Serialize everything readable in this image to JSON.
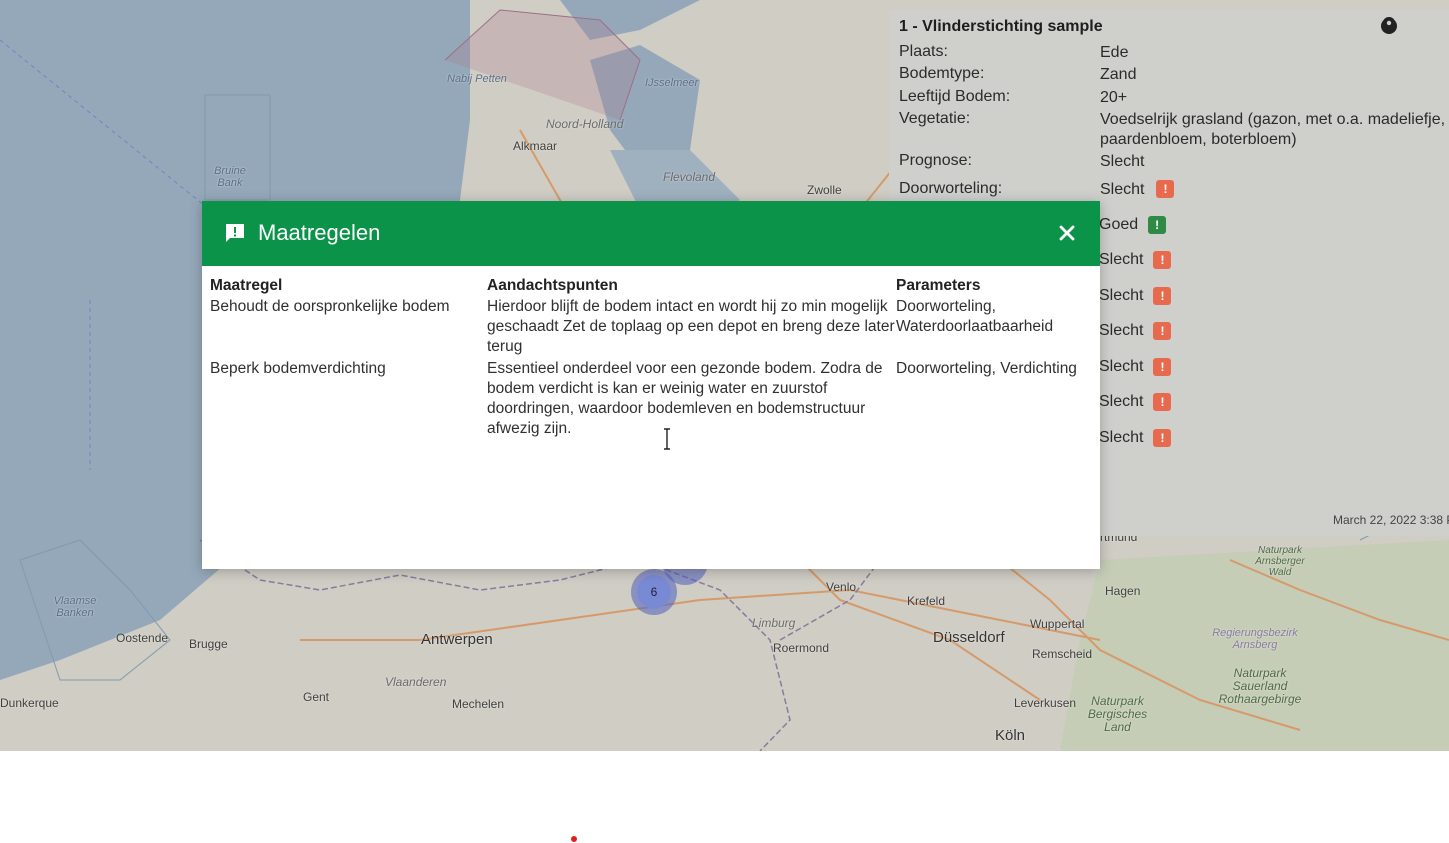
{
  "map": {
    "labels": {
      "nabij_petten": "Nabij Petten",
      "ijsselmeer": "IJsselmeer",
      "noord_holland": "Noord-Holland",
      "alkmaar": "Alkmaar",
      "flevoland": "Flevoland",
      "zwolle": "Zwolle",
      "bruine_bank": "Bruine Bank",
      "vlaamse_banken": "Vlaamse Banken",
      "oostende": "Oostende",
      "brugge": "Brugge",
      "antwerpen": "Antwerpen",
      "gent": "Gent",
      "vlaanderen": "Vlaanderen",
      "mechelen": "Mechelen",
      "dunkerque": "Dunkerque",
      "venlo": "Venlo",
      "krefeld": "Krefeld",
      "limburg": "Limburg",
      "roermond": "Roermond",
      "dusseldorf": "Düsseldorf",
      "wuppertal": "Wuppertal",
      "remscheid": "Remscheid",
      "leverkusen": "Leverkusen",
      "koln": "Köln",
      "hagen": "Hagen",
      "dortmund": "rtmund",
      "np_arnsberger": "Naturpark Arnsberger Wald",
      "reg_arnsberg": "Regierungsbezirk Arnsberg",
      "np_sauerland": "Naturpark Sauerland Rothaargebirge",
      "np_bergisches": "Naturpark Bergisches Land"
    },
    "cluster_count": "6"
  },
  "info_panel": {
    "title": "1 - Vlinderstichting sample",
    "rows": [
      {
        "key": "Plaats:",
        "value": "Ede"
      },
      {
        "key": "Bodemtype:",
        "value": "Zand"
      },
      {
        "key": "Leeftijd Bodem:",
        "value": "20+"
      },
      {
        "key": "Vegetatie:",
        "value": "Voedselrijk grasland (gazon, met o.a. madeliefje, paardenbloem, boterbloem)"
      },
      {
        "key": "Prognose:",
        "value": "Slecht"
      },
      {
        "key": "Doorworteling:",
        "value": "Slecht"
      }
    ],
    "statuses": [
      "Goed",
      "Slecht",
      "Slecht",
      "Slecht",
      "Slecht",
      "Slecht",
      "Slecht"
    ],
    "timestamp": "March 22, 2022 3:38 P",
    "status_colors": {
      "good": "#2e8a44",
      "bad": "#e86a4e"
    }
  },
  "modal": {
    "title": "Maatregelen",
    "header_color": "#0b9449",
    "columns": [
      "Maatregel",
      "Aandachtspunten",
      "Parameters"
    ],
    "rows": [
      {
        "maatregel": "Behoudt de oorspronkelijke bodem",
        "aandachtspunten": "Hierdoor blijft de bodem intact en wordt hij zo min mogelijk  geschaadt Zet de toplaag op een depot en breng deze later terug",
        "parameters": "Doorworteling, Waterdoorlaatbaarheid"
      },
      {
        "maatregel": "Beperk bodemverdichting",
        "aandachtspunten": "Essentieel onderdeel voor een gezonde bodem. Zodra de bodem verdicht is kan er weinig water en zuurstof doordringen, waardoor bodemleven en bodemstructuur afwezig zijn.",
        "parameters": "Doorworteling, Verdichting"
      }
    ]
  }
}
